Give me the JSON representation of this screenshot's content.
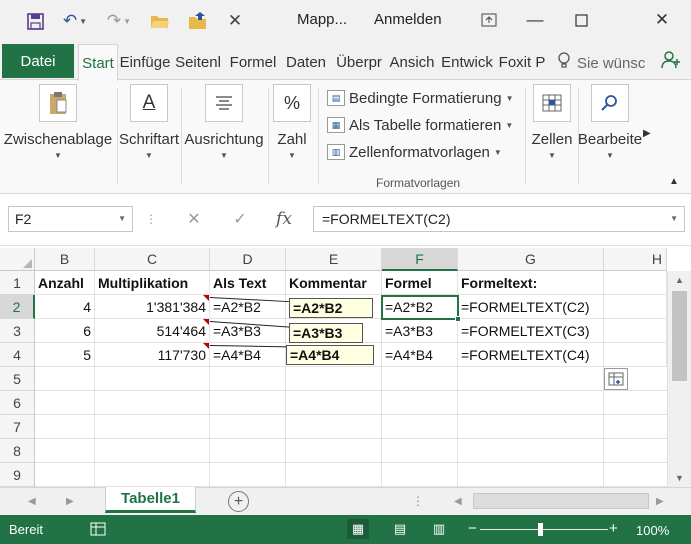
{
  "titlebar": {
    "title": "Mapp...",
    "signin": "Anmelden",
    "icons": [
      "save-icon",
      "undo-icon",
      "redo-icon",
      "open-folder-icon",
      "folder-icon",
      "close-x-icon"
    ]
  },
  "tabs": {
    "file": "Datei",
    "items": [
      "Start",
      "Einfüge",
      "Seitenl",
      "Formel",
      "Daten",
      "Überpr",
      "Ansich",
      "Entwick",
      "Foxit P"
    ],
    "active_index": 0,
    "tellme": "Sie wünsc"
  },
  "ribbon": {
    "buttons": {
      "clipboard": "Zwischenablage",
      "font": "Schriftart",
      "alignment": "Ausrichtung",
      "number": "Zahl",
      "cells": "Zellen",
      "edit": "Bearbeite"
    },
    "styles": {
      "conditional": "Bedingte Formatierung",
      "table": "Als Tabelle formatieren",
      "cellstyles": "Zellenformatvorlagen",
      "group_label": "Formatvorlagen"
    }
  },
  "formula_bar": {
    "namebox": "F2",
    "fx": "fx",
    "formula": "=FORMELTEXT(C2)"
  },
  "grid": {
    "columns": [
      "B",
      "C",
      "D",
      "E",
      "F",
      "G",
      "H"
    ],
    "selected_column": "F",
    "rows": [
      "1",
      "2",
      "3",
      "4",
      "5",
      "6",
      "7",
      "8",
      "9"
    ],
    "selected_row": "2",
    "header_row": {
      "B": "Anzahl",
      "C": "Multiplikation",
      "D": "Als Text",
      "E": "Kommentar",
      "F": "Formel",
      "G": "Formeltext:"
    },
    "data_rows": [
      {
        "B": "4",
        "C": "1'381'384",
        "D": "=A2*B2",
        "F": "=A2*B2",
        "G": "=FORMELTEXT(C2)"
      },
      {
        "B": "6",
        "C": "514'464",
        "D": "=A3*B3",
        "F": "=A3*B3",
        "G": "=FORMELTEXT(C3)"
      },
      {
        "B": "5",
        "C": "117'730",
        "D": "=A4*B4",
        "F": "=A4*B4",
        "G": "=FORMELTEXT(C4)"
      }
    ],
    "comments": [
      "=A2*B2",
      "=A3*B3",
      "=A4*B4"
    ]
  },
  "sheets": {
    "active": "Tabelle1"
  },
  "statusbar": {
    "status": "Bereit",
    "zoom": "100%",
    "zoom_minus": "−",
    "zoom_plus": "+"
  }
}
